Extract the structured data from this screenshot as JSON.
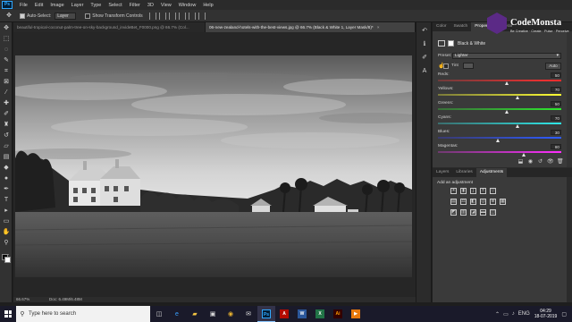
{
  "app": {
    "logo_text": "Ps",
    "menu": [
      "File",
      "Edit",
      "Image",
      "Layer",
      "Type",
      "Select",
      "Filter",
      "3D",
      "View",
      "Window",
      "Help"
    ]
  },
  "options_bar": {
    "auto_select_label": "Auto-Select:",
    "auto_select_value": "Layer",
    "transform_label": "Show Transform Controls"
  },
  "tabs": [
    {
      "label": "beautiful-tropical-coconut-palm-tree-on-sky-background_invideBet_F0000.png @ 66.7% (Col...",
      "active": false
    },
    {
      "label": "06-new-zealand-hotels-with-the-best-views.jpg @ 66.7% (Black & White 1, Layer Mask/8)*",
      "active": true
    }
  ],
  "status": {
    "zoom": "66.67%",
    "doc": "Doc: 6.49M/6.48M"
  },
  "panels": {
    "top_tabs": [
      "Color",
      "Swatch",
      "Properties",
      "Librar"
    ],
    "props_title": "Black & White",
    "preset_label": "Preset:",
    "preset_value": "Lighter",
    "tint_label": "Tint",
    "auto_label": "Auto",
    "sliders": [
      {
        "label": "Reds:",
        "value": 50,
        "pos": 0.565,
        "colors": [
          "#6e3b3b",
          "#ff2e2e"
        ]
      },
      {
        "label": "Yellows:",
        "value": 70,
        "pos": 0.645,
        "colors": [
          "#7a7a3a",
          "#ffff33"
        ]
      },
      {
        "label": "Greens:",
        "value": 50,
        "pos": 0.565,
        "colors": [
          "#3a6e3a",
          "#2ee82e"
        ]
      },
      {
        "label": "Cyans:",
        "value": 70,
        "pos": 0.645,
        "colors": [
          "#3a6e6e",
          "#2ee8e8"
        ]
      },
      {
        "label": "Blues:",
        "value": 30,
        "pos": 0.49,
        "colors": [
          "#3a3a6e",
          "#2e5cff"
        ]
      },
      {
        "label": "Magentas:",
        "value": 80,
        "pos": 0.7,
        "colors": [
          "#6e3a6e",
          "#ff2eff"
        ]
      }
    ],
    "bottom_tabs": [
      "Layers",
      "Libraries",
      "Adjustments"
    ],
    "adj_prompt": "Add an adjustment"
  },
  "brand": {
    "name": "CodeMonsta",
    "tagline": "Be Creative · Create · Pulse · Perceive"
  },
  "taskbar": {
    "search_placeholder": "Type here to search",
    "lang": "ENG",
    "time": "04:29",
    "date": "18-07-2019"
  }
}
